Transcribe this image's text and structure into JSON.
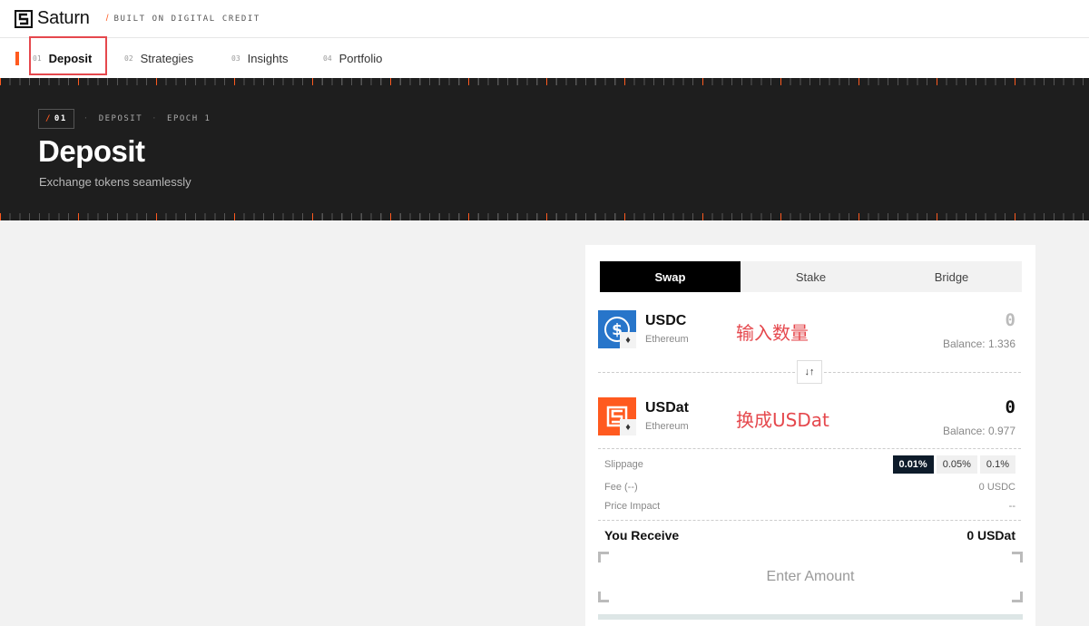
{
  "header": {
    "logo_text": "Saturn",
    "tagline_sep": "/",
    "tagline": "BUILT ON DIGITAL CREDIT"
  },
  "nav": {
    "items": [
      {
        "num": "01",
        "label": "Deposit"
      },
      {
        "num": "02",
        "label": "Strategies"
      },
      {
        "num": "03",
        "label": "Insights"
      },
      {
        "num": "04",
        "label": "Portfolio"
      }
    ]
  },
  "hero": {
    "badge_slash": "/",
    "badge_num": "01",
    "crumb_1": "DEPOSIT",
    "crumb_2": "EPOCH 1",
    "title": "Deposit",
    "subtitle": "Exchange tokens seamlessly"
  },
  "card": {
    "tabs": [
      "Swap",
      "Stake",
      "Bridge"
    ],
    "from": {
      "token": "USDC",
      "chain": "Ethereum",
      "amount": "0",
      "balance": "Balance: 1.336",
      "annotation": "输入数量"
    },
    "to": {
      "token": "USDat",
      "chain": "Ethereum",
      "amount": "0",
      "balance": "Balance: 0.977",
      "annotation": "换成USDat"
    },
    "slippage_label": "Slippage",
    "slippage_options": [
      "0.01%",
      "0.05%",
      "0.1%"
    ],
    "fee_label": "Fee (--)",
    "fee_value": "0 USDC",
    "impact_label": "Price Impact",
    "impact_value": "--",
    "receive_label": "You Receive",
    "receive_value": "0 USDat",
    "enter_amount": "Enter Amount"
  },
  "colors": {
    "accent": "#ff5a1f",
    "usdc_blue": "#2775ca",
    "highlight_red": "#e5484d"
  }
}
